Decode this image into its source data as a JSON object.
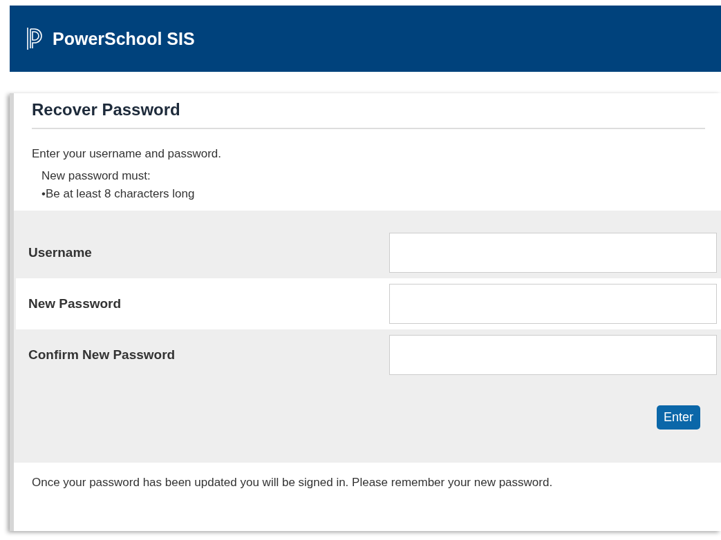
{
  "header": {
    "brand": "PowerSchool SIS"
  },
  "page_title": "Recover Password",
  "intro": "Enter your username and password.",
  "rules_heading": "New password must:",
  "rules": [
    "•Be at least 8 characters long"
  ],
  "fields": [
    {
      "label": "Username"
    },
    {
      "label": "New Password"
    },
    {
      "label": "Confirm New Password"
    }
  ],
  "submit_button": "Enter",
  "footer_note": "Once your password has been updated you will be signed in. Please remember your new password."
}
